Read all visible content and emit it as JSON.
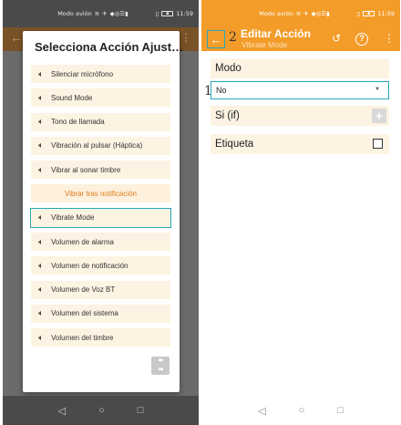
{
  "left_screen": {
    "status": {
      "carrier": "Modo avión",
      "time": "11:59"
    },
    "dialog": {
      "title": "Selecciona Acción Ajust…",
      "items": [
        {
          "label": "Silenciar micrófono",
          "icon": "speaker-icon"
        },
        {
          "label": "Sound Mode",
          "icon": "speaker-icon"
        },
        {
          "label": "Tono de llamada",
          "icon": "speaker-icon"
        },
        {
          "label": "Vibración al pulsar (Háptica)",
          "icon": "speaker-icon"
        },
        {
          "label": "Vibrar al sonar timbre",
          "icon": "speaker-icon"
        },
        {
          "label": "Vibrar tras notificación",
          "section": true
        },
        {
          "label": "Vibrate Mode",
          "icon": "speaker-icon",
          "highlighted": true
        },
        {
          "label": "Volumen de alarma",
          "icon": "speaker-icon"
        },
        {
          "label": "Volumen de notificación",
          "icon": "speaker-icon"
        },
        {
          "label": "Volumen de Voz BT",
          "icon": "speaker-icon"
        },
        {
          "label": "Volumen del sistema",
          "icon": "speaker-icon"
        },
        {
          "label": "Volumen del timbre",
          "icon": "speaker-icon"
        }
      ],
      "grid_icon": "grid-icon"
    }
  },
  "right_screen": {
    "status": {
      "carrier": "Modo avión",
      "time": "11:59"
    },
    "appbar": {
      "title": "Editar Acción",
      "subtitle": "Vibrate Mode",
      "annotation": "2"
    },
    "form": {
      "mode_label": "Modo",
      "mode_value": "No",
      "annotation": "1",
      "if_label": "Si (if)",
      "tag_label": "Etiqueta"
    }
  },
  "colors": {
    "accent_orange": "#f39c29",
    "highlight_teal": "#2aa6b8",
    "item_background": "#fdf3e2",
    "section_text": "#e07b1a"
  }
}
